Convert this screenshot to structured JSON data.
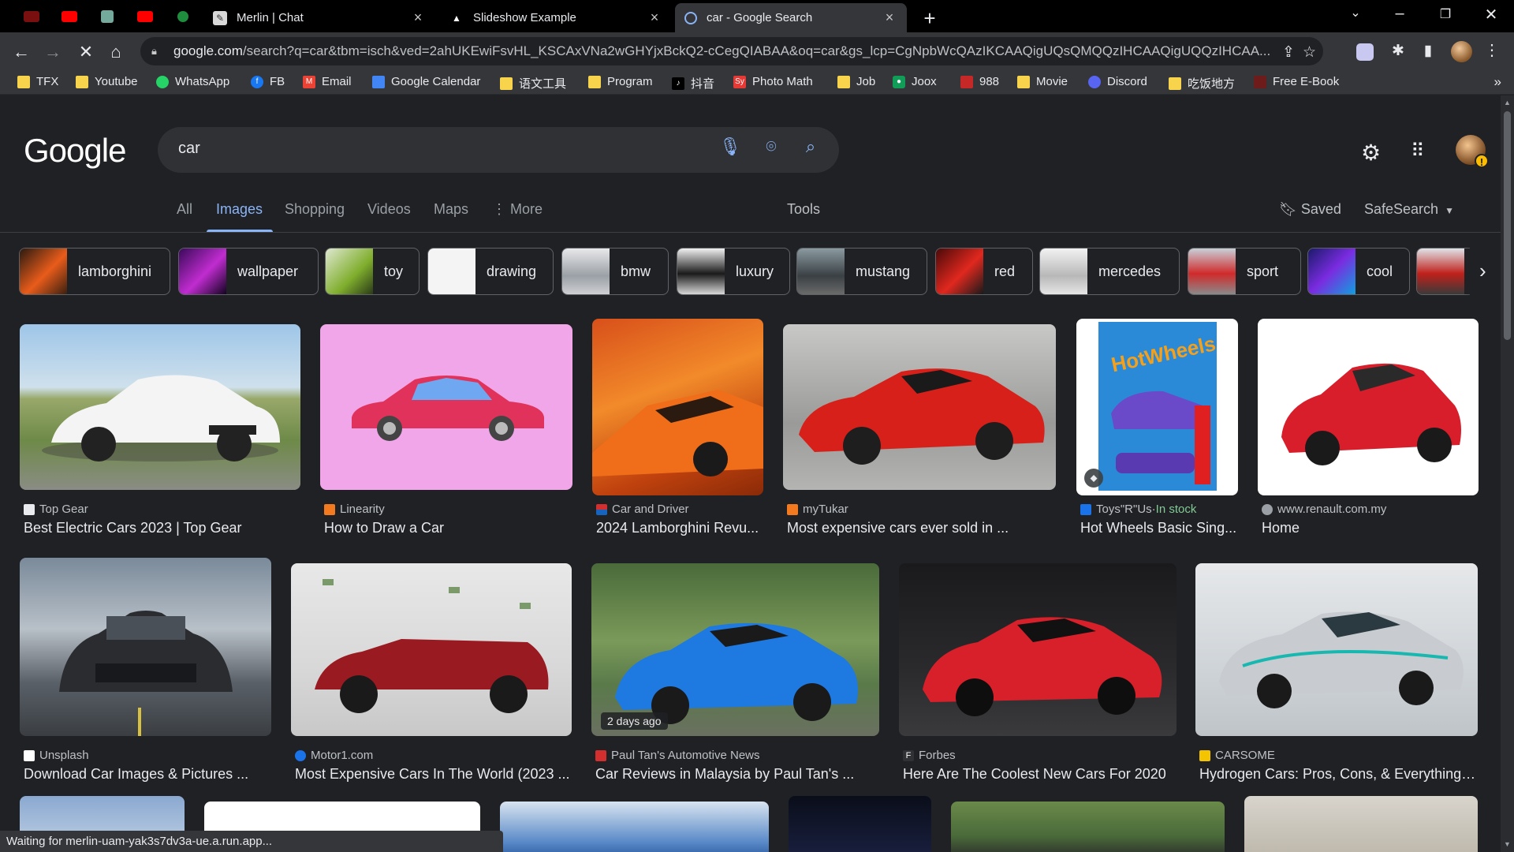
{
  "tabs": [
    {
      "title": "Merlin | Chat",
      "active": false
    },
    {
      "title": "Slideshow Example",
      "active": false
    },
    {
      "title": "car - Google Search",
      "active": true
    }
  ],
  "address": {
    "host": "google.com",
    "path": "/search?q=car&tbm=isch&ved=2ahUKEwiFsvHL_KSCAxVNa2wGHYjxBckQ2-cCegQIABAA&oq=car&gs_lcp=CgNpbWcQAzIKCAAQigUQsQMQQzIHCAAQigUQQzIHCAA..."
  },
  "bookmarks": [
    {
      "label": "TFX",
      "icon": "folder-icon"
    },
    {
      "label": "Youtube",
      "icon": "folder-icon"
    },
    {
      "label": "WhatsApp",
      "icon": "whatsapp-icon"
    },
    {
      "label": "FB",
      "icon": "facebook-icon"
    },
    {
      "label": "Email",
      "icon": "gmail-icon"
    },
    {
      "label": "Google Calendar",
      "icon": "calendar-icon"
    },
    {
      "label": "语文工具",
      "icon": "folder-icon"
    },
    {
      "label": "Program",
      "icon": "folder-icon"
    },
    {
      "label": "抖音",
      "icon": "tiktok-icon"
    },
    {
      "label": "Photo Math",
      "icon": "photomath-icon"
    },
    {
      "label": "Job",
      "icon": "folder-icon"
    },
    {
      "label": "Joox",
      "icon": "joox-icon"
    },
    {
      "label": "988",
      "icon": "988-icon"
    },
    {
      "label": "Movie",
      "icon": "folder-icon"
    },
    {
      "label": "Discord",
      "icon": "discord-icon"
    },
    {
      "label": "吃饭地方",
      "icon": "folder-icon"
    },
    {
      "label": "Free E-Book",
      "icon": "ebook-icon"
    }
  ],
  "google": {
    "logo": "Google",
    "query": "car",
    "nav": [
      "All",
      "Images",
      "Shopping",
      "Videos",
      "Maps",
      "More"
    ],
    "tools": "Tools",
    "saved": "Saved",
    "safesearch": "SafeSearch"
  },
  "chips": [
    "lamborghini",
    "wallpaper",
    "toy",
    "drawing",
    "bmw",
    "luxury",
    "mustang",
    "red",
    "mercedes",
    "sport",
    "cool"
  ],
  "results_row1": [
    {
      "source": "Top Gear",
      "title": "Best Electric Cars 2023 | Top Gear"
    },
    {
      "source": "Linearity",
      "title": "How to Draw a Car"
    },
    {
      "source": "Car and Driver",
      "title": "2024 Lamborghini Revu..."
    },
    {
      "source": "myTukar",
      "title": "Most expensive cars ever sold in ..."
    },
    {
      "source": "Toys\"R\"Us",
      "stock": "In stock",
      "title": "Hot Wheels Basic Sing..."
    },
    {
      "source": "www.renault.com.my",
      "title": "Home"
    }
  ],
  "results_row2": [
    {
      "source": "Unsplash",
      "title": "Download Car Images & Pictures ..."
    },
    {
      "source": "Motor1.com",
      "title": "Most Expensive Cars In The World (2023 ..."
    },
    {
      "source": "Paul Tan's Automotive News",
      "title": "Car Reviews in Malaysia by Paul Tan's ...",
      "badge": "2 days ago"
    },
    {
      "source": "Forbes",
      "title": "Here Are The Coolest New Cars For 2020"
    },
    {
      "source": "CARSOME",
      "title": "Hydrogen Cars: Pros, Cons, & Everything ..."
    }
  ],
  "status_text": "Waiting for merlin-uam-yak3s7dv3a-ue.a.run.app..."
}
